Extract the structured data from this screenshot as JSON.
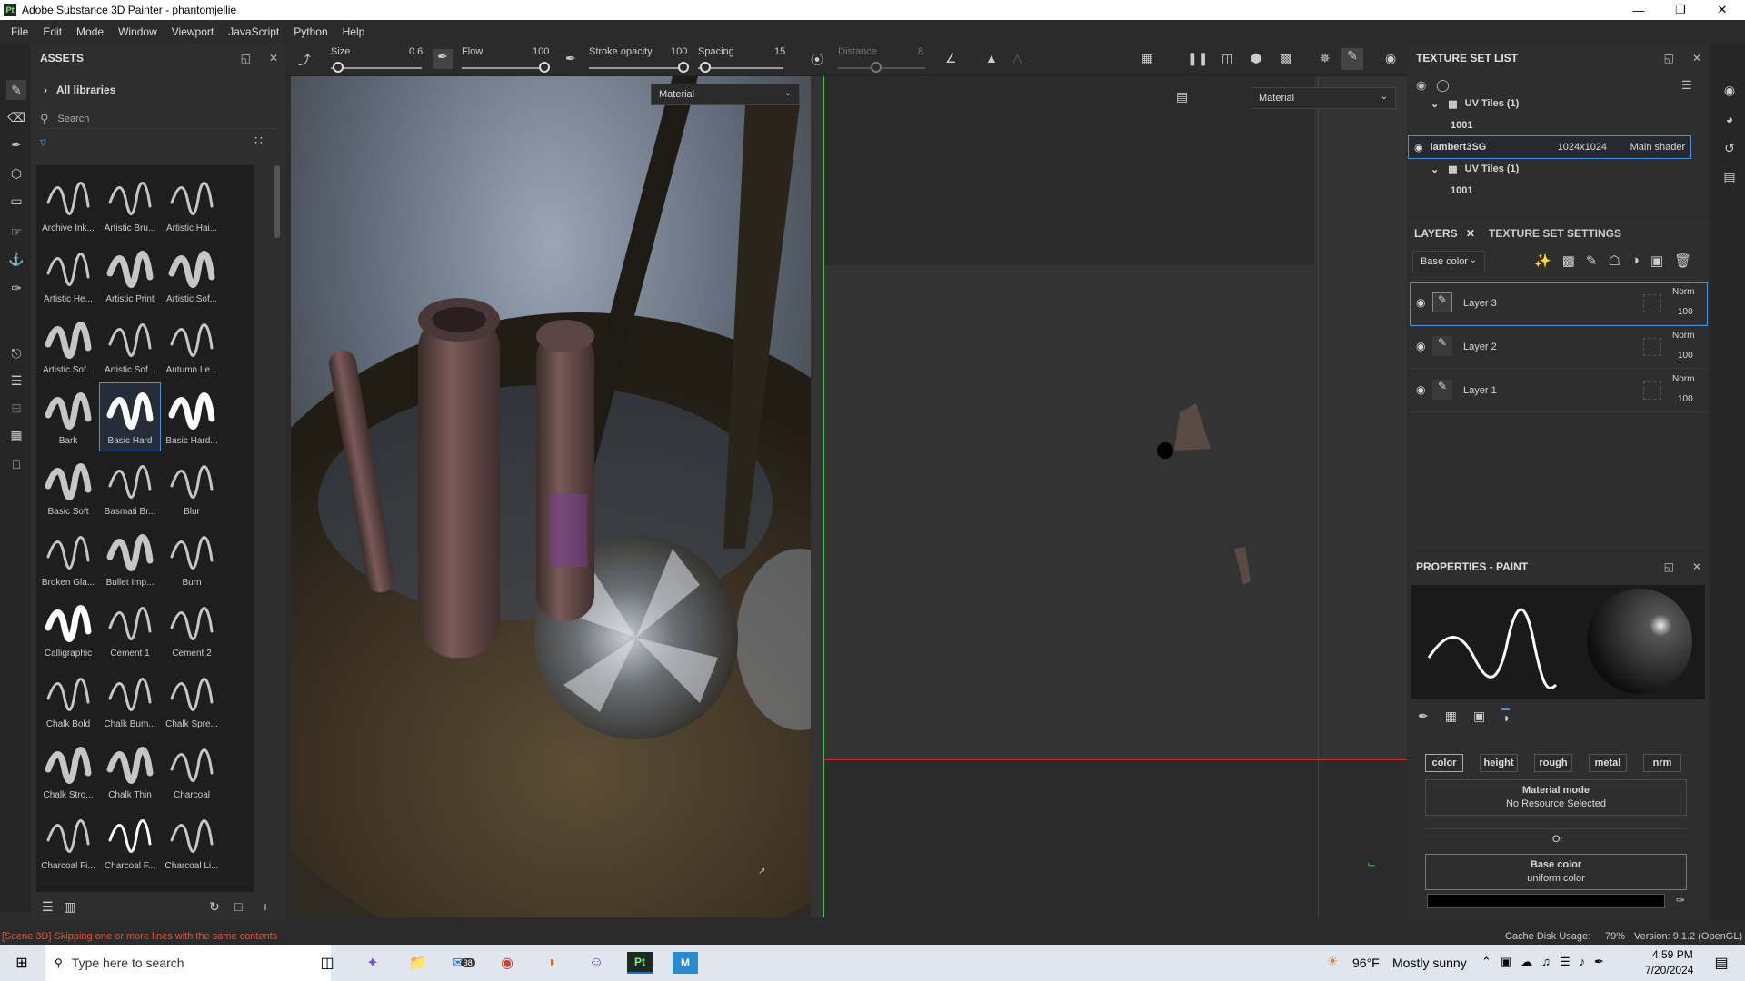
{
  "window": {
    "app_icon": "Pt",
    "title": "Adobe Substance 3D Painter - phantomjellie"
  },
  "menu": [
    "File",
    "Edit",
    "Mode",
    "Window",
    "Viewport",
    "JavaScript",
    "Python",
    "Help"
  ],
  "assets": {
    "title": "ASSETS",
    "library": "All libraries",
    "search_placeholder": "Search",
    "items": [
      "Archive Ink...",
      "Artistic Bru...",
      "Artistic Hai...",
      "Artistic He...",
      "Artistic Print",
      "Artistic Sof...",
      "Artistic Sof...",
      "Artistic Sof...",
      "Autumn Le...",
      "Bark",
      "Basic Hard",
      "Basic Hard...",
      "Basic Soft",
      "Basmati Br...",
      "Blur",
      "Broken Gla...",
      "Bullet Imp...",
      "Burn",
      "Calligraphic",
      "Cement 1",
      "Cement 2",
      "Chalk Bold",
      "Chalk Bum...",
      "Chalk Spre...",
      "Chalk Stro...",
      "Chalk Thin",
      "Charcoal",
      "Charcoal Fi...",
      "Charcoal F...",
      "Charcoal Li..."
    ],
    "selected": "Basic Hard"
  },
  "toolbar": {
    "size_label": "Size",
    "size_value": "0.6",
    "flow_label": "Flow",
    "flow_value": "100",
    "opacity_label": "Stroke opacity",
    "opacity_value": "100",
    "spacing_label": "Spacing",
    "spacing_value": "15",
    "distance_label": "Distance",
    "distance_value": "8"
  },
  "viewport3d": {
    "mode": "Material"
  },
  "viewport2d": {
    "mode": "Material"
  },
  "texture_set_list": {
    "title": "TEXTURE SET LIST",
    "uv_group_1": "UV Tiles (1)",
    "tile_1": "1001",
    "set_name": "lambert3SG",
    "set_res": "1024x1024",
    "set_shader": "Main shader",
    "uv_group_2": "UV Tiles (1)",
    "tile_2": "1001"
  },
  "layers_panel": {
    "tab_layers": "LAYERS",
    "tab_settings": "TEXTURE SET SETTINGS",
    "channel": "Base color",
    "layers": [
      {
        "name": "Layer 3",
        "blend": "Norm",
        "opacity": "100"
      },
      {
        "name": "Layer 2",
        "blend": "Norm",
        "opacity": "100"
      },
      {
        "name": "Layer 1",
        "blend": "Norm",
        "opacity": "100"
      }
    ]
  },
  "properties": {
    "title": "PROPERTIES - PAINT",
    "channels": [
      "color",
      "height",
      "rough",
      "metal",
      "nrm"
    ],
    "material_mode_title": "Material mode",
    "material_mode_value": "No Resource Selected",
    "or_text": "Or",
    "base_color_title": "Base color",
    "base_color_value": "uniform color"
  },
  "status": {
    "message": "[Scene 3D] Skipping one or more lines with the same contents",
    "cache": "Cache Disk Usage:",
    "cache_pct": "79%",
    "version": "| Version: 9.1.2 (OpenGL)"
  },
  "taskbar": {
    "search_placeholder": "Type here to search",
    "mail_badge": "38",
    "weather_temp": "96°F",
    "weather_text": "Mostly sunny",
    "time": "4:59 PM",
    "date": "7/20/2024"
  },
  "colors": {
    "accent": "#4a90e2",
    "status_error": "#e0553b",
    "axis_green": "#3cc24a",
    "axis_red": "#d03030"
  }
}
